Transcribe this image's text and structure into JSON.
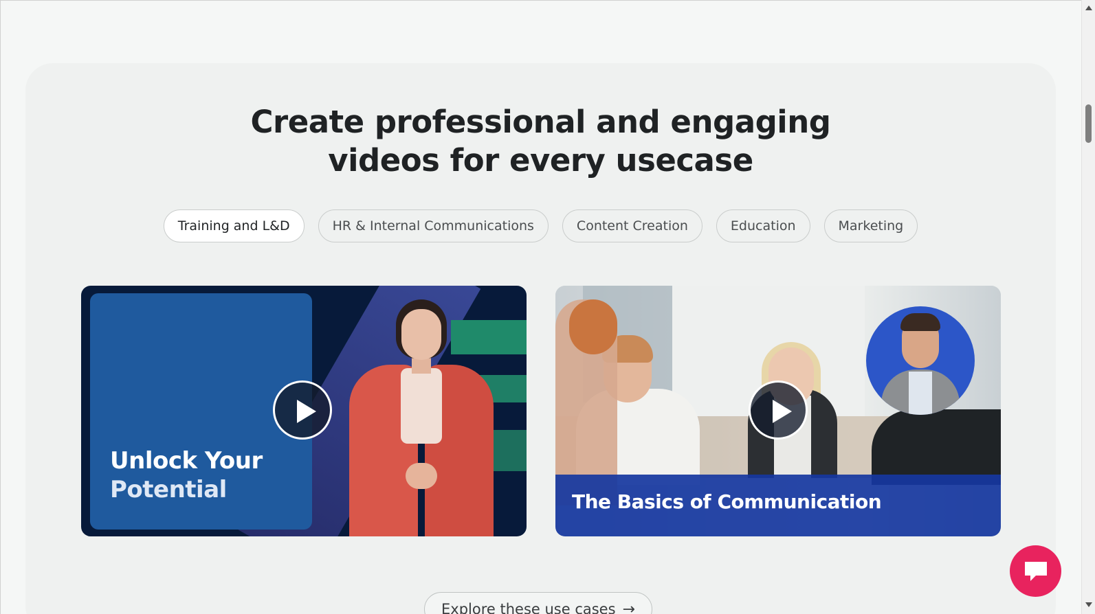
{
  "section": {
    "headline_line1": "Create professional and engaging",
    "headline_line2": "videos for every usecase"
  },
  "tabs": [
    {
      "label": "Training and L&D",
      "active": true
    },
    {
      "label": "HR & Internal Communications",
      "active": false
    },
    {
      "label": "Content Creation",
      "active": false
    },
    {
      "label": "Education",
      "active": false
    },
    {
      "label": "Marketing",
      "active": false
    }
  ],
  "cards": [
    {
      "title_line1": "Unlock Your",
      "title_line2": "Potential",
      "icon": "play-icon"
    },
    {
      "title": "The Basics of Communication",
      "icon": "play-icon"
    }
  ],
  "explore_button": {
    "label": "Explore these use cases",
    "arrow": "→"
  },
  "chat_widget": {
    "icon": "chat-bubble-icon",
    "color": "#e8235e"
  },
  "colors": {
    "accent_pink": "#e8235e",
    "card1_panel": "#1f5a9e",
    "card2_band": "#1637a0"
  }
}
